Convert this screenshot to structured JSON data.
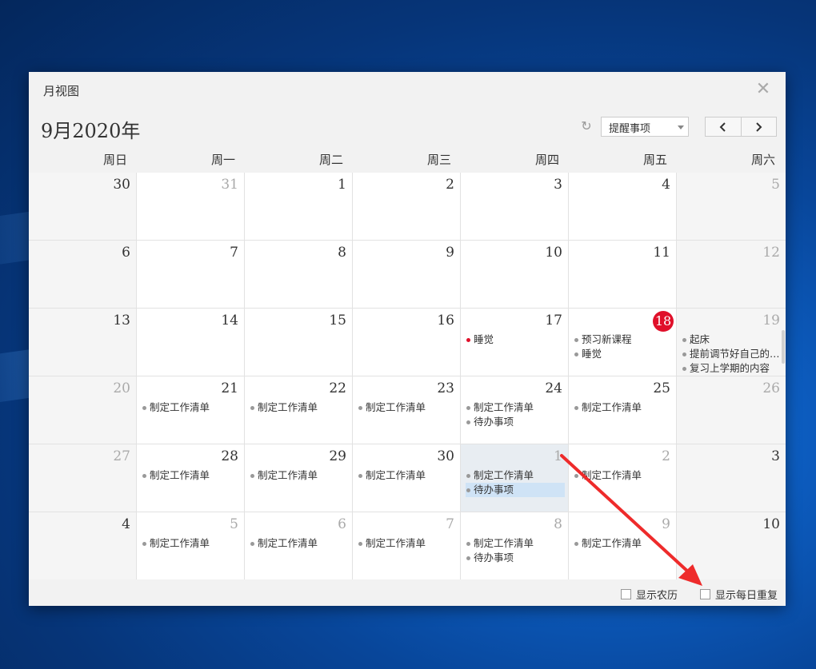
{
  "window": {
    "title": "月视图",
    "close_icon": "close-icon"
  },
  "header": {
    "month_title": "9月2020年",
    "refresh_icon": "refresh-icon",
    "filter_value": "提醒事项",
    "prev_icon": "chevron-left-icon",
    "next_icon": "chevron-right-icon"
  },
  "weekdays": [
    "周日",
    "周一",
    "周二",
    "周三",
    "周四",
    "周五",
    "周六"
  ],
  "weeks": [
    [
      {
        "day": "30",
        "dim": false,
        "events": []
      },
      {
        "day": "31",
        "dim": true,
        "events": []
      },
      {
        "day": "1",
        "dim": false,
        "events": []
      },
      {
        "day": "2",
        "dim": false,
        "events": []
      },
      {
        "day": "3",
        "dim": false,
        "events": []
      },
      {
        "day": "4",
        "dim": false,
        "events": []
      },
      {
        "day": "5",
        "dim": true,
        "events": []
      }
    ],
    [
      {
        "day": "6",
        "dim": false,
        "events": []
      },
      {
        "day": "7",
        "dim": false,
        "events": []
      },
      {
        "day": "8",
        "dim": false,
        "events": []
      },
      {
        "day": "9",
        "dim": false,
        "events": []
      },
      {
        "day": "10",
        "dim": false,
        "events": []
      },
      {
        "day": "11",
        "dim": false,
        "events": []
      },
      {
        "day": "12",
        "dim": true,
        "events": []
      }
    ],
    [
      {
        "day": "13",
        "dim": false,
        "events": []
      },
      {
        "day": "14",
        "dim": false,
        "events": []
      },
      {
        "day": "15",
        "dim": false,
        "events": []
      },
      {
        "day": "16",
        "dim": false,
        "events": []
      },
      {
        "day": "17",
        "dim": false,
        "events": [
          {
            "text": "睡觉",
            "red": true
          }
        ]
      },
      {
        "day": "18",
        "dim": false,
        "today": true,
        "events": [
          {
            "text": "预习新课程"
          },
          {
            "text": "睡觉"
          }
        ]
      },
      {
        "day": "19",
        "dim": true,
        "scroll": true,
        "events": [
          {
            "text": "起床"
          },
          {
            "text": "提前调节好自己的…"
          },
          {
            "text": "复习上学期的内容"
          }
        ]
      }
    ],
    [
      {
        "day": "20",
        "dim": true,
        "events": []
      },
      {
        "day": "21",
        "dim": false,
        "events": [
          {
            "text": "制定工作清单"
          }
        ]
      },
      {
        "day": "22",
        "dim": false,
        "events": [
          {
            "text": "制定工作清单"
          }
        ]
      },
      {
        "day": "23",
        "dim": false,
        "events": [
          {
            "text": "制定工作清单"
          }
        ]
      },
      {
        "day": "24",
        "dim": false,
        "events": [
          {
            "text": "制定工作清单"
          },
          {
            "text": "待办事项"
          }
        ]
      },
      {
        "day": "25",
        "dim": false,
        "events": [
          {
            "text": "制定工作清单"
          }
        ]
      },
      {
        "day": "26",
        "dim": true,
        "events": []
      }
    ],
    [
      {
        "day": "27",
        "dim": true,
        "events": []
      },
      {
        "day": "28",
        "dim": false,
        "events": [
          {
            "text": "制定工作清单"
          }
        ]
      },
      {
        "day": "29",
        "dim": false,
        "events": [
          {
            "text": "制定工作清单"
          }
        ]
      },
      {
        "day": "30",
        "dim": false,
        "events": [
          {
            "text": "制定工作清单"
          }
        ]
      },
      {
        "day": "1",
        "dim": true,
        "selected": true,
        "events": [
          {
            "text": "制定工作清单"
          },
          {
            "text": "待办事项",
            "hl": true
          }
        ]
      },
      {
        "day": "2",
        "dim": true,
        "events": [
          {
            "text": "制定工作清单"
          }
        ]
      },
      {
        "day": "3",
        "dim": false,
        "events": []
      }
    ],
    [
      {
        "day": "4",
        "dim": false,
        "events": []
      },
      {
        "day": "5",
        "dim": true,
        "events": [
          {
            "text": "制定工作清单"
          }
        ]
      },
      {
        "day": "6",
        "dim": true,
        "events": [
          {
            "text": "制定工作清单"
          }
        ]
      },
      {
        "day": "7",
        "dim": true,
        "events": [
          {
            "text": "制定工作清单"
          }
        ]
      },
      {
        "day": "8",
        "dim": true,
        "events": [
          {
            "text": "制定工作清单"
          },
          {
            "text": "待办事项"
          }
        ]
      },
      {
        "day": "9",
        "dim": true,
        "events": [
          {
            "text": "制定工作清单"
          }
        ]
      },
      {
        "day": "10",
        "dim": false,
        "events": []
      }
    ]
  ],
  "footer": {
    "lunar_label": "显示农历",
    "daily_repeat_label": "显示每日重复"
  },
  "colors": {
    "today_badge": "#e0102a",
    "annotation_arrow": "#ee2b2b",
    "highlight": "#cfe3f6"
  }
}
